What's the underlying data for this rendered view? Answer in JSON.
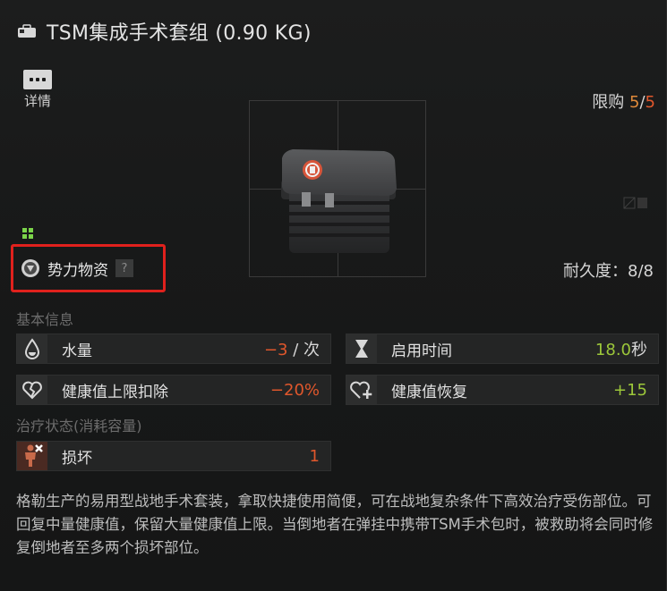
{
  "title": "TSM集成手术套组 (0.90 KG)",
  "detail_label": "详情",
  "limit": {
    "label": "限购 ",
    "current": "5",
    "sep": "/",
    "max": "5"
  },
  "faction_label": "势力物资",
  "help_mark": "?",
  "durability": "耐久度：8/8",
  "basic_info_label": "基本信息",
  "stats": [
    {
      "name": "水量",
      "value": "−3",
      "unit": " / 次",
      "color": "red",
      "icon": "water-drop-icon"
    },
    {
      "name": "启用时间",
      "value": "18.0",
      "unit": "秒",
      "color": "green",
      "icon": "hourglass-icon"
    },
    {
      "name": "健康值上限扣除",
      "value": "−20%",
      "unit": "",
      "color": "red",
      "icon": "broken-heart-icon"
    },
    {
      "name": "健康值恢复",
      "value": "+15",
      "unit": "",
      "color": "green",
      "icon": "heart-plus-icon"
    }
  ],
  "treatment_label": "治疗状态(消耗容量)",
  "treatment": {
    "name": "损坏",
    "value": "1",
    "icon": "damaged-body-icon"
  },
  "description": "格勒生产的易用型战地手术套装，拿取快捷使用简便，可在战地复杂条件下高效治疗受伤部位。可回复中量健康值，保留大量健康值上限。当倒地者在弹挂中携带TSM手术包时，被救助将会同时修复倒地者至多两个损坏部位。",
  "colors": {
    "accent_orange": "#e0572c",
    "accent_green": "#9cc73a",
    "highlight_red": "#e0211d"
  }
}
